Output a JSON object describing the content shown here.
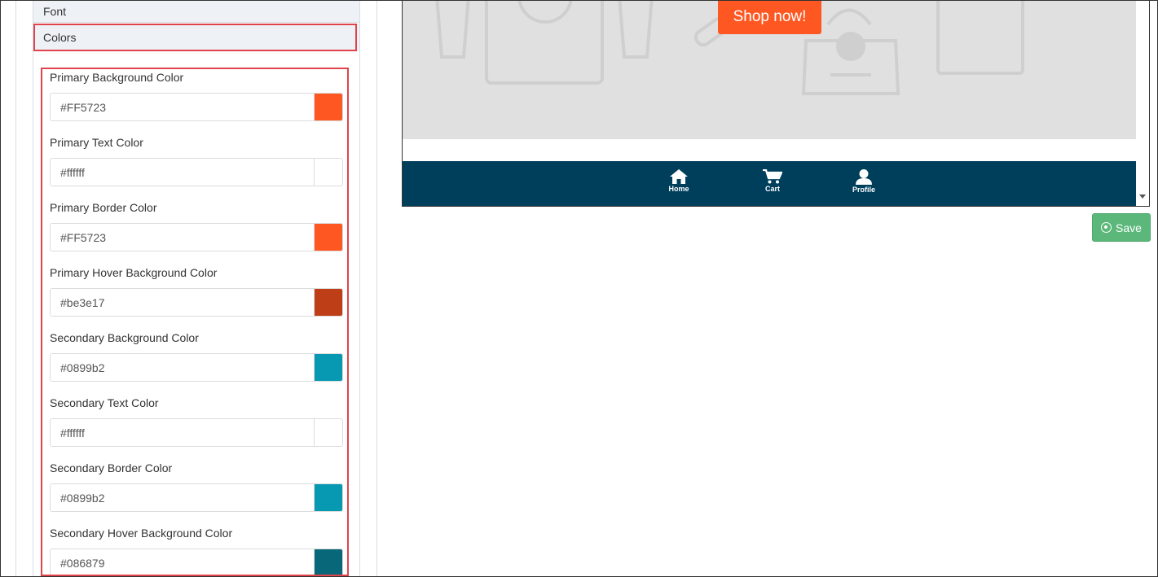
{
  "sidebar": {
    "font_label": "Font",
    "colors_label": "Colors"
  },
  "colors": [
    {
      "label": "Primary Background Color",
      "value": "#FF5723",
      "swatch": "#ff5722"
    },
    {
      "label": "Primary Text Color",
      "value": "#ffffff",
      "swatch": "#ffffff"
    },
    {
      "label": "Primary Border Color",
      "value": "#FF5723",
      "swatch": "#ff5722"
    },
    {
      "label": "Primary Hover Background Color",
      "value": "#be3e17",
      "swatch": "#be3e17"
    },
    {
      "label": "Secondary Background Color",
      "value": "#0899b2",
      "swatch": "#0899b2"
    },
    {
      "label": "Secondary Text Color",
      "value": "#ffffff",
      "swatch": "#ffffff"
    },
    {
      "label": "Secondary Border Color",
      "value": "#0899b2",
      "swatch": "#0899b2"
    },
    {
      "label": "Secondary Hover Background Color",
      "value": "#086879",
      "swatch": "#086879"
    }
  ],
  "preview": {
    "shop_button": "Shop now!",
    "nav": {
      "home": "Home",
      "cart": "Cart",
      "profile": "Profile"
    }
  },
  "actions": {
    "save": "Save"
  },
  "theme": {
    "highlight": "#e0434b",
    "navbar": "#003f5c",
    "save_green": "#5cb87a"
  }
}
